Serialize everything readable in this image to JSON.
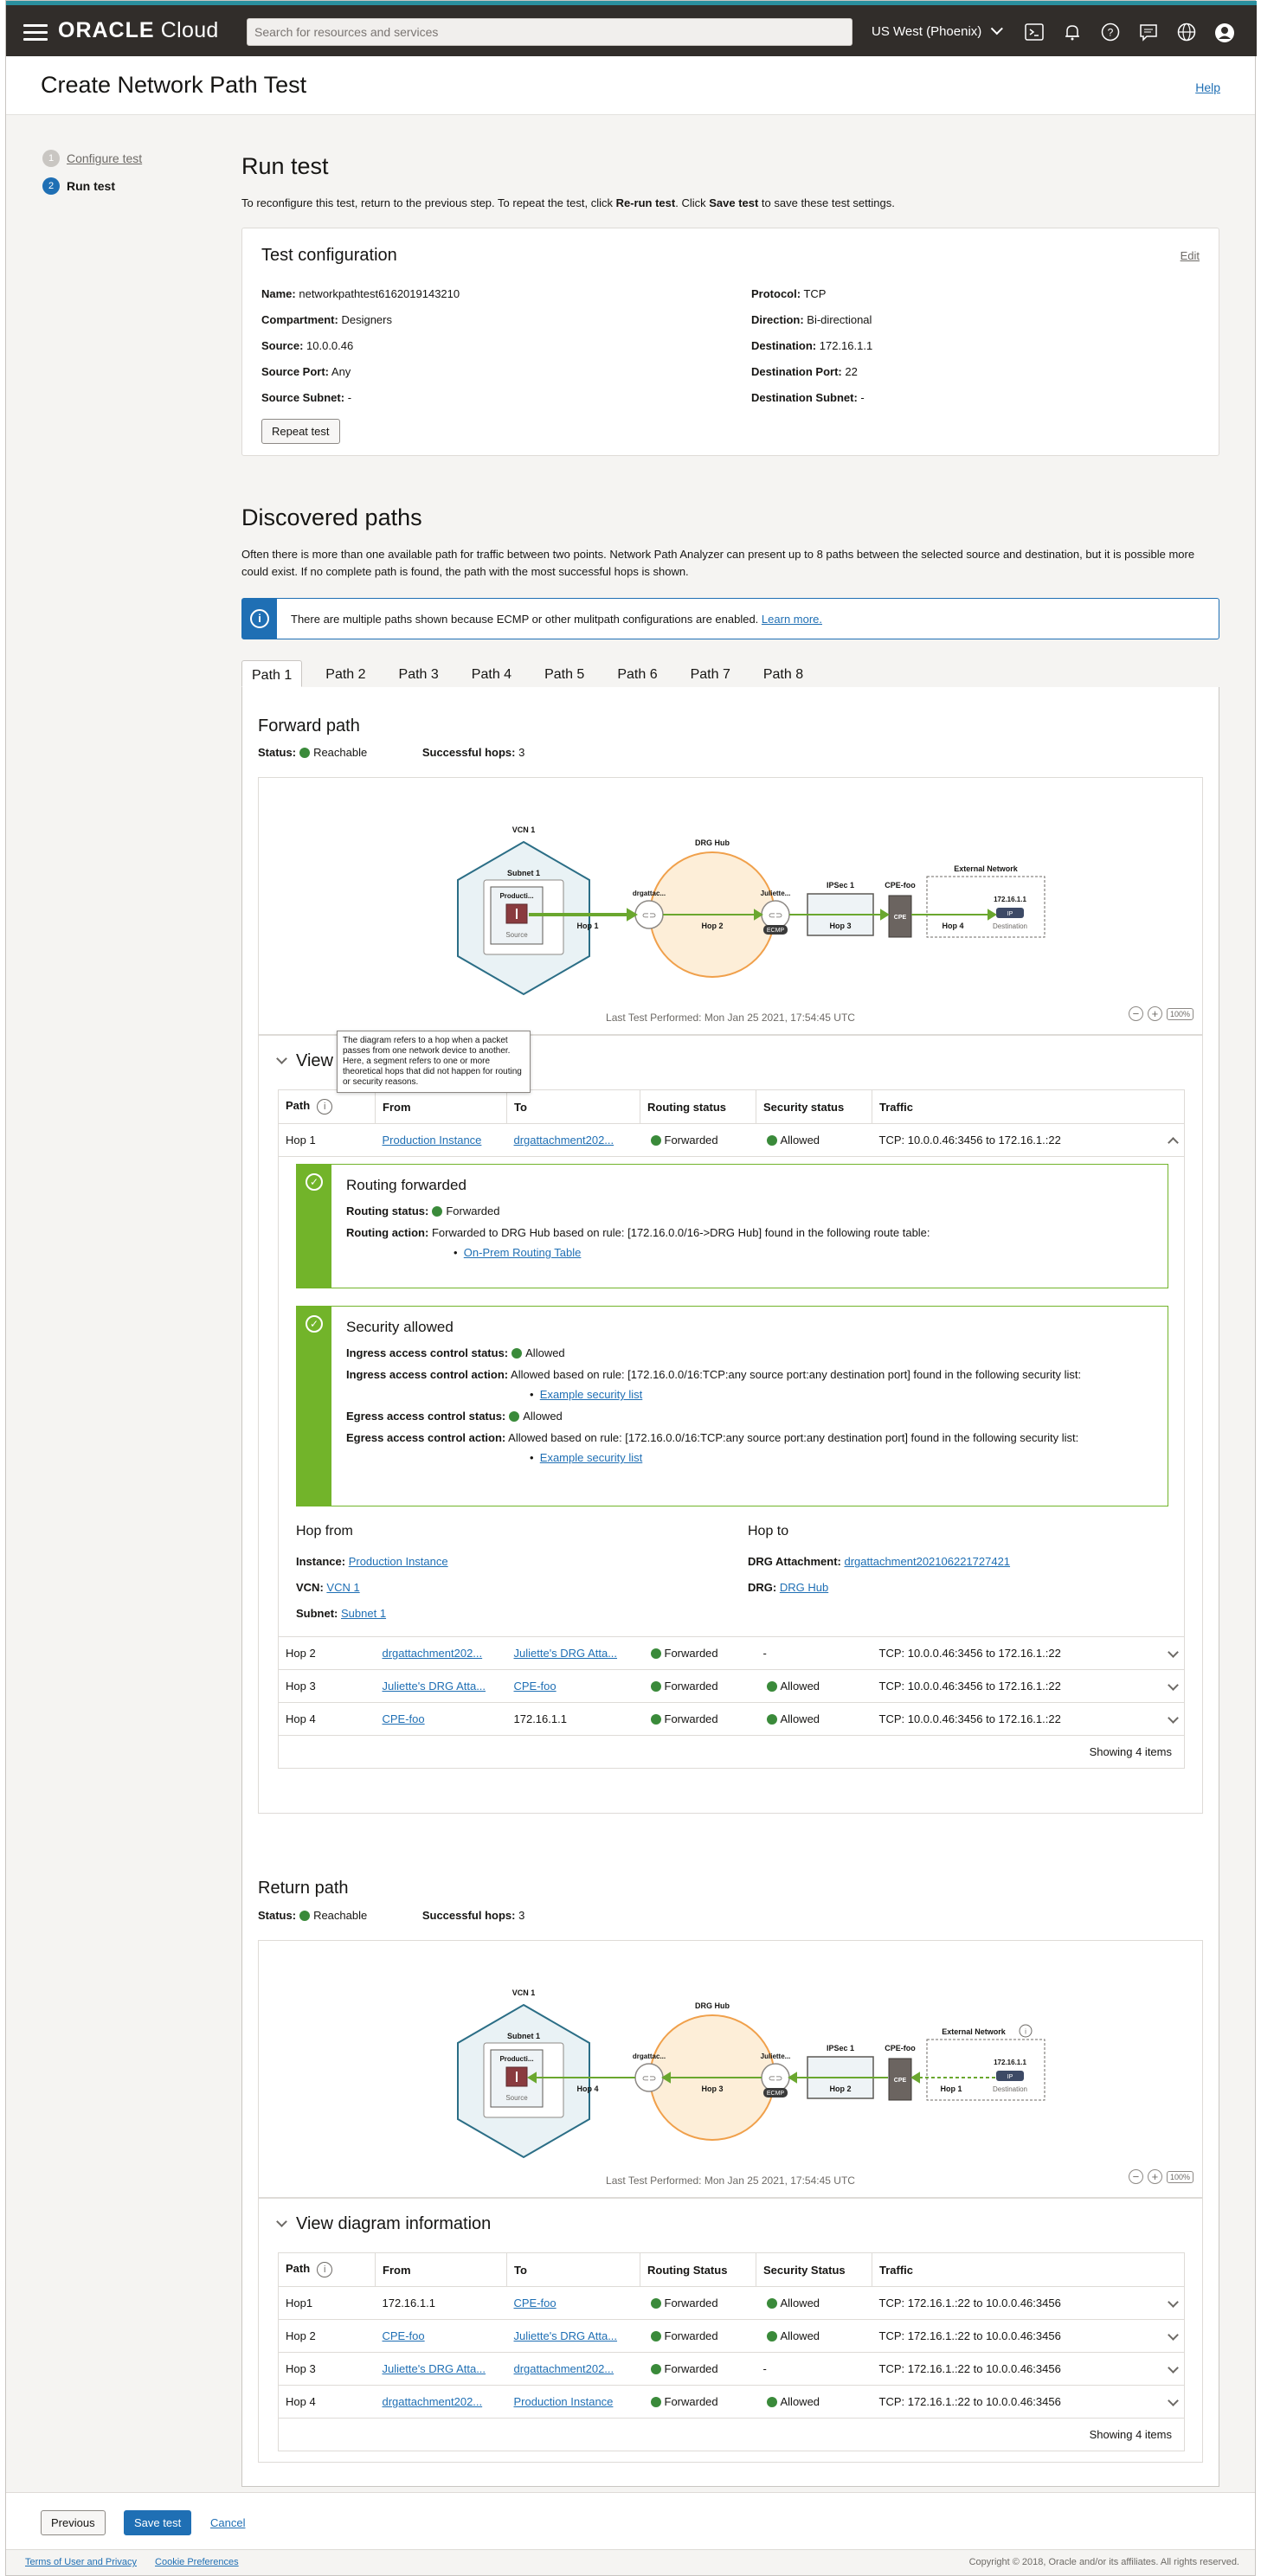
{
  "nav": {
    "brand_bold": "ORACLE",
    "brand_rest": " Cloud",
    "search_placeholder": "Search for resources and services",
    "region": "US West (Phoenix)"
  },
  "page": {
    "title": "Create Network Path Test",
    "help": "Help"
  },
  "steps": [
    {
      "num": "1",
      "label": "Configure test"
    },
    {
      "num": "2",
      "label": "Run test"
    }
  ],
  "run": {
    "title": "Run test",
    "desc_a": "To reconfigure this test, return to the previous step. To repeat the test, click ",
    "desc_b": "Re-run test",
    "desc_c": ". Click ",
    "desc_d": "Save test",
    "desc_e": " to save these test settings."
  },
  "config": {
    "title": "Test configuration",
    "edit": "Edit",
    "left": [
      {
        "k": "Name:",
        "v": " networkpathtest6162019143210"
      },
      {
        "k": "Compartment:",
        "v": " Designers"
      },
      {
        "k": "Source:",
        "v": " 10.0.0.46"
      },
      {
        "k": "Source Port:",
        "v": " Any"
      },
      {
        "k": "Source Subnet:",
        "v": " -"
      }
    ],
    "right": [
      {
        "k": "Protocol:",
        "v": " TCP"
      },
      {
        "k": "Direction:",
        "v": " Bi-directional"
      },
      {
        "k": "Destination:",
        "v": " 172.16.1.1"
      },
      {
        "k": "Destination Port:",
        "v": " 22"
      },
      {
        "k": "Destination Subnet:",
        "v": " -"
      }
    ],
    "repeat": "Repeat test"
  },
  "discovered": {
    "title": "Discovered paths",
    "desc": "Often there is more than one available path for traffic between two points. Network Path Analyzer can present up to 8 paths between the selected source and destination, but it is possible more could exist. If no complete path is found, the path with the most successful hops is shown.",
    "info": "There are multiple paths shown because ECMP or other mulitpath configurations are enabled.",
    "learn": "Learn more.",
    "tabs": [
      "Path 1",
      "Path 2",
      "Path 3",
      "Path 4",
      "Path 5",
      "Path 6",
      "Path 7",
      "Path 8"
    ]
  },
  "forward": {
    "title": "Forward path",
    "status_k": "Status:",
    "status_v": "Reachable",
    "hops_k": "Successful hops:",
    "hops_v": " 3",
    "last_test": "Last Test Performed: Mon Jan 25 2021, 17:54:45 UTC",
    "zoom": "100%",
    "info_title": "View diagram information",
    "tooltip": "The diagram refers to a hop when a packet passes from one network device to another. Here, a segment refers to one or more theoretical hops that did not happen for routing or security reasons.",
    "cols": [
      "Path",
      "From",
      "To",
      "Routing status",
      "Security status",
      "Traffic"
    ],
    "rows": [
      {
        "path": "Hop 1",
        "from": "Production Instance",
        "to": "drgattachment202...",
        "routing": "Forwarded",
        "security": "Allowed",
        "traffic": "TCP: 10.0.0.46:3456 to 172.16.1.:22"
      },
      {
        "path": "Hop 2",
        "from": "drgattachment202...",
        "to": "Juliette's DRG Atta...",
        "routing": "Forwarded",
        "security": "-",
        "traffic": "TCP: 10.0.0.46:3456 to 172.16.1.:22"
      },
      {
        "path": "Hop 3",
        "from": "Juliette's DRG Atta...",
        "to": "CPE-foo",
        "routing": "Forwarded",
        "security": "Allowed",
        "traffic": "TCP: 10.0.0.46:3456 to 172.16.1.:22"
      },
      {
        "path": "Hop 4",
        "from": "CPE-foo",
        "to": "172.16.1.1",
        "routing": "Forwarded",
        "security": "Allowed",
        "traffic": "TCP: 10.0.0.46:3456 to 172.16.1.:22"
      }
    ],
    "routing": {
      "title": "Routing forwarded",
      "status_k": "Routing status:",
      "status_v": "Forwarded",
      "action_k": "Routing action:",
      "action_v": " Forwarded to DRG Hub based on rule: [172.16.0.0/16->DRG Hub] found in the following route table:",
      "link": "On-Prem Routing Table"
    },
    "security": {
      "title": "Security allowed",
      "in_status_k": "Ingress access control status:",
      "in_status_v": "Allowed",
      "in_action_k": "Ingress access control action:",
      "in_action_v": " Allowed based on rule: [172.16.0.0/16:TCP:any source port:any destination port] found in the following security list:",
      "in_link": "Example security list",
      "eg_status_k": "Egress access control status:",
      "eg_status_v": "Allowed",
      "eg_action_k": "Egress access control action:",
      "eg_action_v": " Allowed based on rule: [172.16.0.0/16:TCP:any source port:any destination port] found in the following security list:",
      "eg_link": "Example security list"
    },
    "hop_from": {
      "title": "Hop from",
      "instance_k": "Instance:",
      "instance_v": "Production Instance",
      "vcn_k": "VCN:",
      "vcn_v": "VCN 1",
      "subnet_k": "Subnet:",
      "subnet_v": "Subnet 1"
    },
    "hop_to": {
      "title": "Hop to",
      "drgatt_k": "DRG Attachment:",
      "drgatt_v": "drgattachment20210622172742​1",
      "drg_k": "DRG:",
      "drg_v": "DRG Hub"
    },
    "showing": "Showing 4 items"
  },
  "ret": {
    "title": "Return path",
    "status_k": "Status:",
    "status_v": "Reachable",
    "hops_k": "Successful hops:",
    "hops_v": " 3",
    "last_test": "Last Test Performed: Mon Jan 25 2021, 17:54:45 UTC",
    "zoom": "100%",
    "info_title": "View diagram information",
    "cols": [
      "Path",
      "From",
      "To",
      "Routing Status",
      "Security Status",
      "Traffic"
    ],
    "rows": [
      {
        "path": "Hop1",
        "from": "172.16.1.1",
        "to": "CPE-foo",
        "routing": "Forwarded",
        "security": "Allowed",
        "traffic": "TCP: 172.16.1.:22 to 10.0.0.46:3456"
      },
      {
        "path": "Hop 2",
        "from": "CPE-foo",
        "to": "Juliette's DRG Atta...",
        "routing": "Forwarded",
        "security": "Allowed",
        "traffic": "TCP: 172.16.1.:22 to 10.0.0.46:3456"
      },
      {
        "path": "Hop 3",
        "from": "Juliette's DRG Atta...",
        "to": "drgattachment202...",
        "routing": "Forwarded",
        "security": "-",
        "traffic": "TCP: 172.16.1.:22 to 10.0.0.46:3456"
      },
      {
        "path": "Hop 4",
        "from": "drgattachment202...",
        "to": "Production Instance",
        "routing": "Forwarded",
        "security": "Allowed",
        "traffic": "TCP: 172.16.1.:22 to 10.0.0.46:3456"
      }
    ],
    "showing": "Showing 4 items"
  },
  "diagram": {
    "vcn": "VCN 1",
    "subnet": "Subnet 1",
    "instance": "Producti...",
    "source": "Source",
    "drg_hub": "DRG Hub",
    "drgatt": "drgattac...",
    "juliette": "Juliette...",
    "ecmp": "ECMP",
    "ipsec": "IPSec 1",
    "cpefoo": "CPE-foo",
    "cpe": "CPE",
    "extnet": "External Network",
    "ip": "172.16.1.1",
    "ipbadge": "IP",
    "dest": "Destination",
    "hops": [
      "Hop 1",
      "Hop 2",
      "Hop 3",
      "Hop 4"
    ]
  },
  "footer_actions": {
    "previous": "Previous",
    "save": "Save test",
    "cancel": "Cancel"
  },
  "footer": {
    "terms": "Terms of User and Privacy",
    "cookies": "Cookie Preferences",
    "copyright": "Copyright © 2018, Oracle and/or its affiliates. All rights reserved."
  },
  "colors": {
    "accent": "#1f6fb4",
    "success": "#3a8a3a",
    "alert_green": "#72b42a",
    "arrow_green": "#6aa72e",
    "drg_orange": "#f0a04b",
    "vcn_blue": "#2b6e86",
    "topbar": "#312d2a"
  }
}
